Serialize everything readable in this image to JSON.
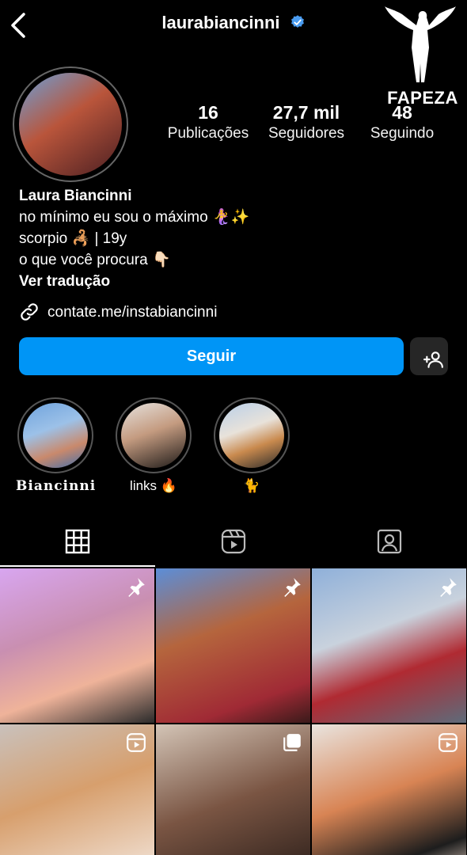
{
  "header": {
    "username": "laurabiancinni",
    "verified": true,
    "back_icon": "chevron-left-icon",
    "verified_icon": "verified-badge-icon"
  },
  "watermark": {
    "text": "FAPEZA"
  },
  "profile": {
    "stats": [
      {
        "value": "16",
        "label": "Publicações"
      },
      {
        "value": "27,7 mil",
        "label": "Seguidores"
      },
      {
        "value": "48",
        "label": "Seguindo"
      }
    ],
    "name": "Laura Biancinni",
    "bio_lines": [
      "no mínimo eu sou o máximo 🧜‍♀️✨",
      "scorpio 🦂 | 19y",
      "o que você procura 👇🏻"
    ],
    "translate_label": "Ver tradução",
    "link": "contate.me/instabiancinni"
  },
  "actions": {
    "follow_label": "Seguir",
    "suggest_icon": "add-person-icon"
  },
  "highlights": [
    {
      "label": "𝐁𝐢𝐚𝐧𝐜𝐢𝐧𝐧𝐢"
    },
    {
      "label": "links 🔥"
    },
    {
      "label": "🐈"
    }
  ],
  "tabs": [
    {
      "icon": "grid-icon",
      "active": true
    },
    {
      "icon": "reels-icon",
      "active": false
    },
    {
      "icon": "tagged-icon",
      "active": false
    }
  ],
  "grid": [
    {
      "badge": "pin-icon"
    },
    {
      "badge": "pin-icon"
    },
    {
      "badge": "pin-icon"
    },
    {
      "badge": "reel-badge-icon"
    },
    {
      "badge": "carousel-icon"
    },
    {
      "badge": "reel-badge-icon"
    }
  ],
  "colors": {
    "background": "#000000",
    "primary_button": "#0095f6",
    "secondary_button": "#262626",
    "verified": "#4a9cf0"
  }
}
